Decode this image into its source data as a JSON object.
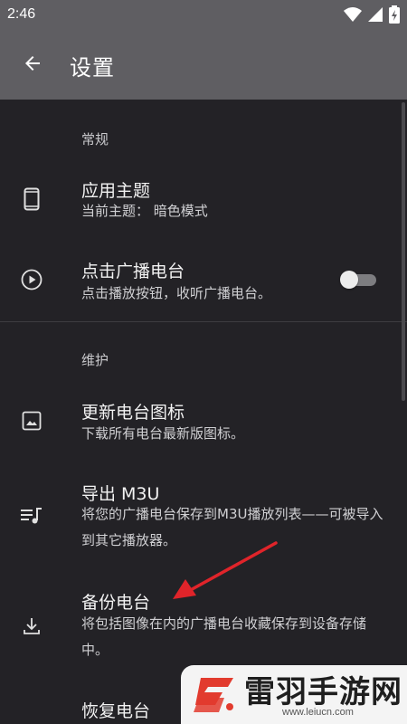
{
  "status_bar": {
    "time": "2:46",
    "icons": [
      "wifi-icon",
      "signal-icon",
      "battery-charging-icon"
    ]
  },
  "app_bar": {
    "back_icon": "arrow-left-icon",
    "title": "设置"
  },
  "sections": [
    {
      "header": "常规",
      "items": [
        {
          "icon": "phone-icon",
          "title": "应用主题",
          "subtitle": "当前主题： 暗色模式"
        },
        {
          "icon": "play-circle-icon",
          "title": "点击广播电台",
          "subtitle": "点击播放按钮，收听广播电台。",
          "toggle_on": false
        }
      ]
    },
    {
      "header": "维护",
      "items": [
        {
          "icon": "image-icon",
          "title": "更新电台图标",
          "subtitle": "下载所有电台最新版图标。"
        },
        {
          "icon": "playlist-music-icon",
          "title": "导出 M3U",
          "subtitle": "将您的广播电台保存到M3U播放列表——可被导入到其它播放器。"
        },
        {
          "icon": "download-icon",
          "title": "备份电台",
          "subtitle": "将包括图像在内的广播电台收藏保存到设备存储中。"
        },
        {
          "icon": "",
          "title": "恢复电台",
          "subtitle": ""
        }
      ]
    }
  ],
  "annotation": {
    "icon": "red-arrow-icon",
    "color": "#e0242a"
  },
  "watermark": {
    "name": "雷羽手游网",
    "url": "www.leiucn.com"
  },
  "colors": {
    "background": "#232226",
    "app_bar": "#5f5e62",
    "text": "#f2f2f2"
  }
}
